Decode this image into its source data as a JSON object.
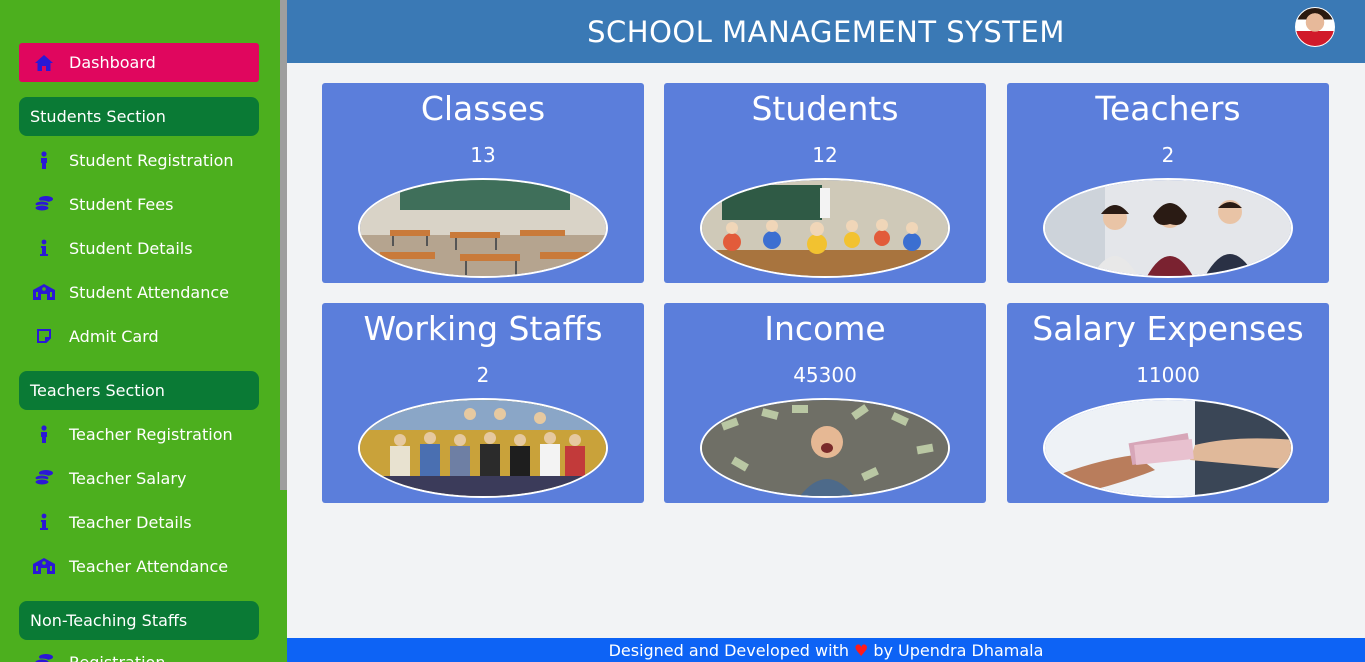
{
  "app": {
    "title": "SCHOOL MANAGEMENT SYSTEM"
  },
  "sidebar": {
    "dashboard": {
      "label": "Dashboard",
      "icon": "home-icon"
    },
    "students_section": "Students Section",
    "student_items": [
      {
        "label": "Student Registration",
        "icon": "person-icon"
      },
      {
        "label": "Student Fees",
        "icon": "coins-icon"
      },
      {
        "label": "Student Details",
        "icon": "info-icon"
      },
      {
        "label": "Student Attendance",
        "icon": "school-icon"
      },
      {
        "label": "Admit Card",
        "icon": "card-icon"
      }
    ],
    "teachers_section": "Teachers Section",
    "teacher_items": [
      {
        "label": "Teacher Registration",
        "icon": "person-icon"
      },
      {
        "label": "Teacher Salary",
        "icon": "coins-icon"
      },
      {
        "label": "Teacher Details",
        "icon": "info-icon"
      },
      {
        "label": "Teacher Attendance",
        "icon": "school-icon"
      }
    ],
    "nonteaching_section": "Non-Teaching Staffs",
    "nonteaching_items": [
      {
        "label": "Registration",
        "icon": "coins-icon"
      }
    ]
  },
  "cards": [
    {
      "title": "Classes",
      "value": "13",
      "image": "classroom-photo"
    },
    {
      "title": "Students",
      "value": "12",
      "image": "students-photo"
    },
    {
      "title": "Teachers",
      "value": "2",
      "image": "teachers-photo"
    },
    {
      "title": "Working Staffs",
      "value": "2",
      "image": "staff-group-photo"
    },
    {
      "title": "Income",
      "value": "45300",
      "image": "money-rain-photo"
    },
    {
      "title": "Salary Expenses",
      "value": "11000",
      "image": "cash-handover-photo"
    }
  ],
  "footer": {
    "before": "Designed and Developed with",
    "after": "by Upendra Dhamala"
  },
  "colors": {
    "sidebar_bg": "#4caf1e",
    "active_item": "#e0065e",
    "section_head": "#0a7a35",
    "header_bg": "#3a79b5",
    "card_bg": "#5b7edb",
    "footer_bg": "#0d63f5",
    "icon_color": "#2a18d6"
  }
}
